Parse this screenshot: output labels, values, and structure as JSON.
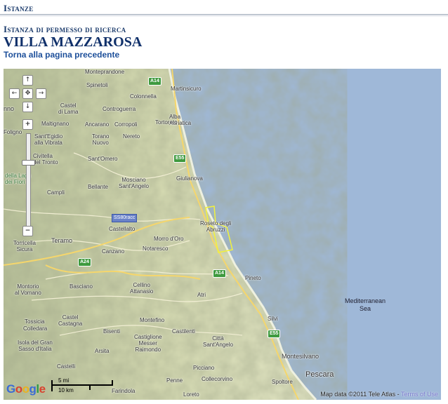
{
  "header": {
    "section_title": "Istanze",
    "subtitle": "Istanza di permesso di ricerca",
    "name": "VILLA MAZZAROSA",
    "back_link": "Torna alla pagina precedente"
  },
  "map": {
    "places": {
      "monteprandone": "Monteprandone",
      "spinetoli": "Spinetoli",
      "colonnella": "Colonnella",
      "martinsicuro": "Martinsicuro",
      "castel_di_lama": "Castel\ndi Lama",
      "controguerra": "Controguerra",
      "alba_adriatica": "Alba\nAdriatica",
      "maltignano": "Maltignano",
      "ancarano": "Ancarano",
      "corropoli": "Corropoli",
      "torano_nuovo": "Torano\nNuovo",
      "nereto": "Nereto",
      "tortoreto": "Tortoreto",
      "santegidio": "Sant'Egidio\nalla Vibrata",
      "civitella": "Civitella\ndel Tronto",
      "santomero": "Sant'Omero",
      "giulianova": "Giulianova",
      "campli": "Campli",
      "bellante": "Bellante",
      "mosciano": "Mosciano\nSant'Angelo",
      "castellalto": "Castellalto",
      "roseto": "Roseto degli\nAbruzzi",
      "teramo": "Teramo",
      "morro": "Morro d'Oro",
      "canzano": "Canzano",
      "notaresco": "Notaresco",
      "torricella": "Torricella\nSicura",
      "montorio": "Montorio\nal Vomano",
      "basciano": "Basciano",
      "cellino": "Cellino\nAttanasio",
      "pineto": "Pineto",
      "atri": "Atri",
      "tossicia": "Tossicia",
      "colledara": "Colledara",
      "castel_castagna": "Castel\nCastagna",
      "bisenti": "Bisenti",
      "montefino": "Montefino",
      "castilenti": "Castilenti",
      "silvi": "Silvi",
      "isola": "Isola del Gran\nSasso d'Italia",
      "arsita": "Arsita",
      "castiglione": "Castiglione\nMesser\nRaimondo",
      "citta_santangelo": "Città\nSant'Angelo",
      "montesilvano": "Montesilvano",
      "castelli": "Castelli",
      "picciano": "Picciano",
      "pescara": "Pescara",
      "collecorvino": "Collecorvino",
      "spoltore": "Spoltore",
      "penne": "Penne",
      "loreto": "Loreto",
      "farindola": "Farindola",
      "nno": "nno",
      "foligno": "Foligno",
      "della_laga": "della Laga\ndei Fiori"
    },
    "sea_label": "Mediterranean\nSea",
    "road_shields": {
      "a14": "A14",
      "e55a": "E55",
      "a24": "A24",
      "a14b": "A14",
      "e55b": "E55"
    },
    "road_tag": "SS80racc",
    "controls": {
      "up": "↑",
      "left": "←",
      "center": "✥",
      "right": "→",
      "down": "↓",
      "zoom_in": "+",
      "zoom_out": "−"
    },
    "google_logo": "Google",
    "scale": {
      "miles": "5 mi",
      "km": "10 km"
    },
    "attribution": "Map data ©2011 Tele Atlas - ",
    "terms": "Terms of Use"
  },
  "colors": {
    "sea": "#aac0de",
    "land": "#d4d9b0",
    "highlight": "#f2f23a"
  }
}
